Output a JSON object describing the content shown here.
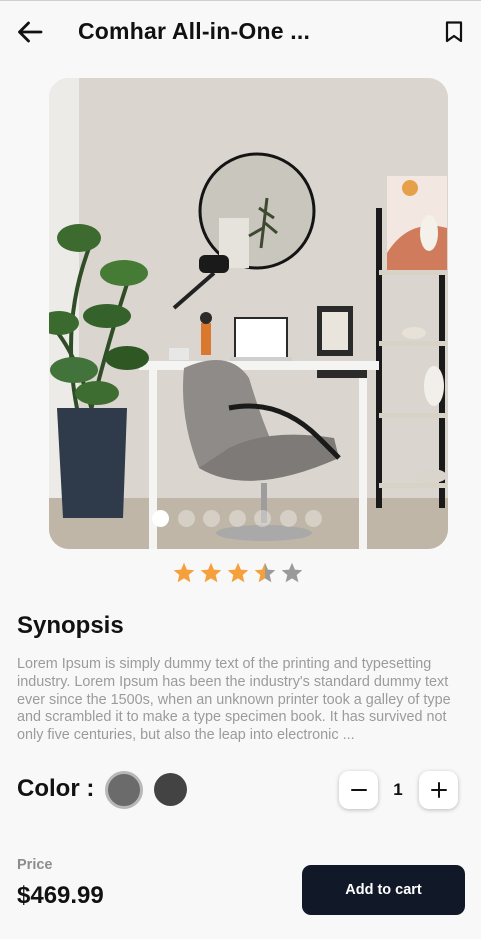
{
  "header": {
    "title": "Comhar All-in-One ...",
    "back_icon": "arrow-left-icon",
    "bookmark_icon": "bookmark-icon"
  },
  "gallery": {
    "total_images": 7,
    "active_index": 0
  },
  "rating": {
    "value": 3.5,
    "max": 5,
    "star_color": "#f5a03b",
    "empty_color": "#9a9a9a"
  },
  "synopsis": {
    "title": "Synopsis",
    "text": "Lorem Ipsum is simply dummy text of the printing and typesetting industry. Lorem Ipsum has been the industry's standard dummy text ever since the 1500s, when an unknown printer took a galley of type and scrambled it to make a type specimen book. It has survived not only five centuries, but also the leap into electronic ..."
  },
  "color": {
    "label": "Color :",
    "options": [
      "#6b6b6b",
      "#434343"
    ],
    "selected": 0
  },
  "quantity": {
    "value": "1",
    "minus_icon": "minus-icon",
    "plus_icon": "plus-icon"
  },
  "footer": {
    "price_label": "Price",
    "price": "$469.99",
    "add_to_cart": "Add to cart",
    "button_color": "#111827"
  }
}
